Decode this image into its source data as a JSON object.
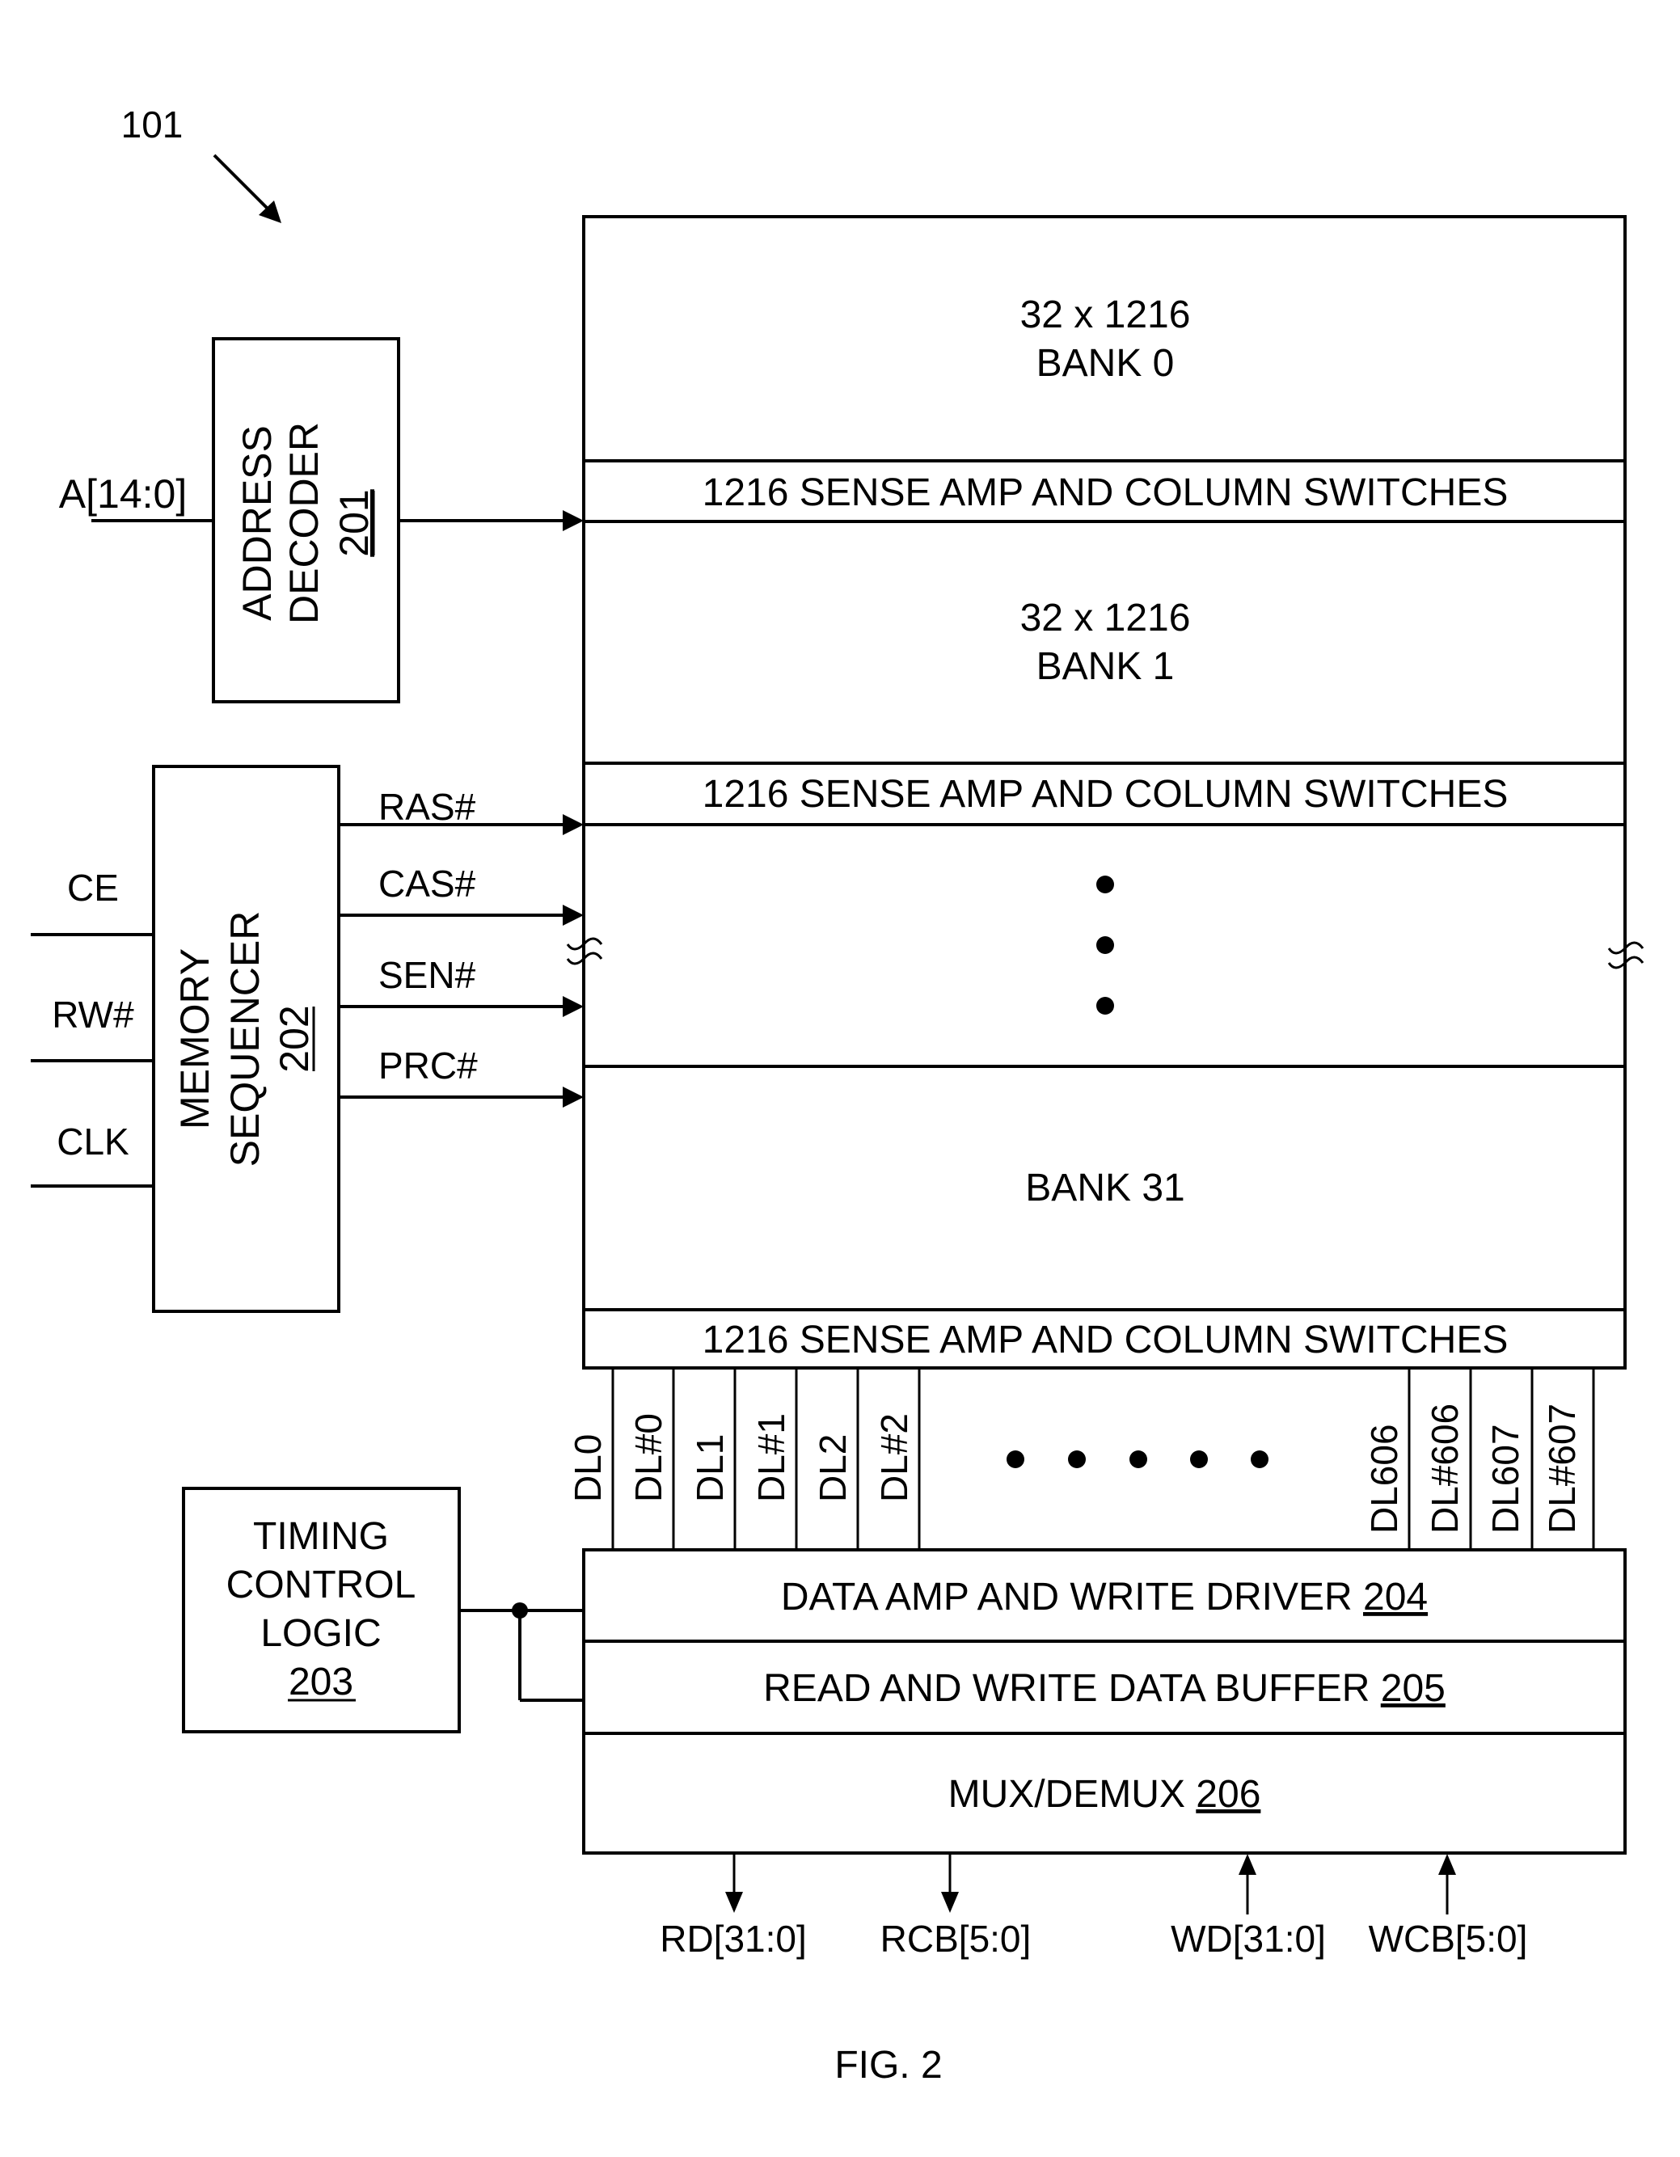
{
  "figure": {
    "reference_label": "101",
    "caption": "FIG. 2"
  },
  "address_decoder": {
    "input_label": "A[14:0]",
    "lines": [
      "ADDRESS",
      "DECODER"
    ],
    "ref": "201"
  },
  "memory_sequencer": {
    "inputs": [
      "CE",
      "RW#",
      "CLK"
    ],
    "lines": [
      "MEMORY",
      "SEQUENCER"
    ],
    "ref": "202",
    "outputs": [
      "RAS#",
      "CAS#",
      "SEN#",
      "PRC#"
    ]
  },
  "memory_array": {
    "bank0": {
      "size": "32 x 1216",
      "name": "BANK 0"
    },
    "sense_amp_label": "1216 SENSE AMP AND COLUMN SWITCHES",
    "bank1": {
      "size": "32 x 1216",
      "name": "BANK 1"
    },
    "bank31": {
      "name": "BANK 31"
    }
  },
  "data_lines": {
    "left": [
      "DL0",
      "DL#0",
      "DL1",
      "DL#1",
      "DL2",
      "DL#2"
    ],
    "right": [
      "DL606",
      "DL#606",
      "DL607",
      "DL#607"
    ]
  },
  "timing_control": {
    "lines": [
      "TIMING",
      "CONTROL",
      "LOGIC"
    ],
    "ref": "203"
  },
  "data_path": {
    "data_amp": {
      "label": "DATA AMP AND WRITE DRIVER ",
      "ref": "204"
    },
    "buffer": {
      "label": "READ AND WRITE DATA BUFFER ",
      "ref": "205"
    },
    "mux": {
      "label": "MUX/DEMUX ",
      "ref": "206"
    }
  },
  "io_signals": {
    "outputs": [
      "RD[31:0]",
      "RCB[5:0]"
    ],
    "inputs": [
      "WD[31:0]",
      "WCB[5:0]"
    ]
  }
}
